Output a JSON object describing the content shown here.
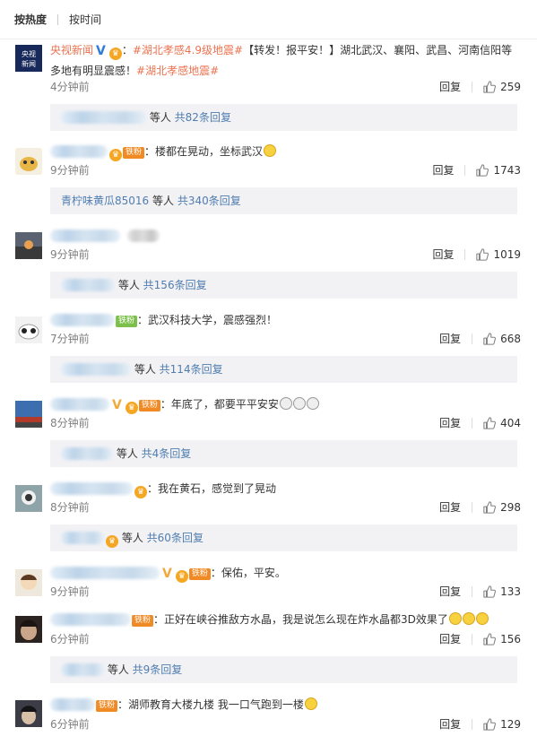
{
  "sort_tabs": [
    {
      "label": "按热度",
      "active": true
    },
    {
      "label": "按时间",
      "active": false
    }
  ],
  "reply_label": "回复",
  "comments": [
    {
      "user": "央视新闻",
      "topic_tag": "#湖北孝感4.9级地震#",
      "text": "【转发！报平安！】湖北武汉、襄阳、武昌、河南信阳等多地有明显震感！",
      "topic_tag_2": "#湖北孝感地震#",
      "time": "4分钟前",
      "likes": "259",
      "sub": {
        "suffix": "等人",
        "count": "共82条回复"
      }
    },
    {
      "fan_badge": "铁粉",
      "text": "：楼都在晃动，坐标武汉",
      "time": "9分钟前",
      "likes": "1743",
      "sub": {
        "name": "青柠味黄瓜85016",
        "suffix": "等人",
        "count": "共340条回复"
      }
    },
    {
      "text": "",
      "time": "9分钟前",
      "likes": "1019",
      "sub": {
        "suffix": "等人",
        "count": "共156条回复"
      }
    },
    {
      "fan_badge": "铁粉",
      "text": "：武汉科技大学，震感强烈！",
      "time": "7分钟前",
      "likes": "668",
      "sub": {
        "suffix": "等人",
        "count": "共114条回复"
      }
    },
    {
      "fan_badge": "铁粉",
      "text": "：年底了，都要平平安安",
      "time": "8分钟前",
      "likes": "404",
      "sub": {
        "suffix": "等人",
        "count": "共4条回复"
      }
    },
    {
      "text": "：我在黄石，感觉到了晃动",
      "time": "8分钟前",
      "likes": "298",
      "sub": {
        "suffix": "等人",
        "count": "共60条回复"
      }
    },
    {
      "fan_badge": "铁粉",
      "text": "：保佑，平安。",
      "time": "9分钟前",
      "likes": "133",
      "sub": null
    },
    {
      "fan_badge": "铁粉",
      "text": "：正好在峡谷推敌方水晶，我是说怎么现在炸水晶都3D效果了",
      "time": "6分钟前",
      "likes": "156",
      "sub": {
        "suffix": "等人",
        "count": "共9条回复"
      }
    },
    {
      "fan_badge": "铁粉",
      "text": "：湖师教育大楼九楼 我一口气跑到一楼",
      "time": "6分钟前",
      "likes": "129",
      "sub": null
    }
  ],
  "colors": {
    "accent": "#eb7350",
    "link_blue": "#507daf",
    "sub_bg": "#f2f2f5"
  },
  "icons": [
    "thumbs-up-icon",
    "verified-badge-icon",
    "medal-icon"
  ]
}
